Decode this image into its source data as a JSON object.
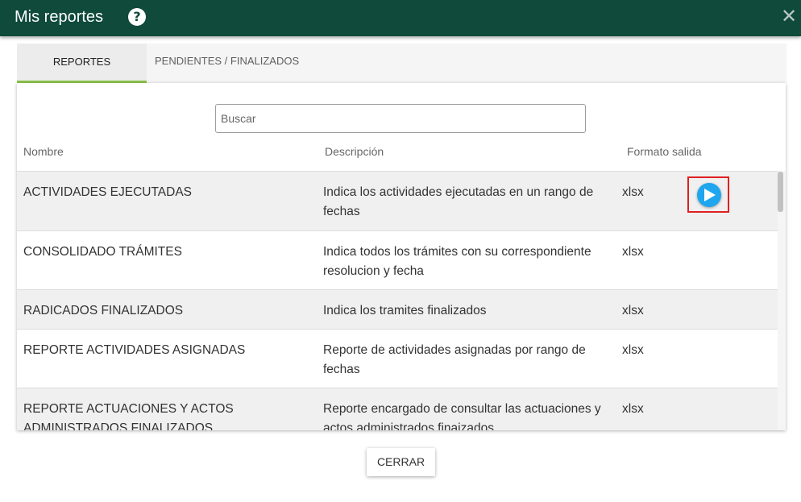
{
  "dialog": {
    "title": "Mis reportes",
    "help_glyph": "?",
    "close_glyph": "✕"
  },
  "tabs": [
    {
      "label": "REPORTES",
      "active": true
    },
    {
      "label": "PENDIENTES / FINALIZADOS",
      "active": false
    }
  ],
  "search": {
    "placeholder": "Buscar",
    "value": ""
  },
  "columns": {
    "name": "Nombre",
    "description": "Descripción",
    "format": "Formato salida"
  },
  "rows": [
    {
      "name": "ACTIVIDADES EJECUTADAS",
      "description": "Indica los actividades ejecutadas en un rango de fechas",
      "format": "xlsx"
    },
    {
      "name": "CONSOLIDADO TRÁMITES",
      "description": "Indica todos los trámites con su correspondiente resolucion y fecha",
      "format": "xlsx"
    },
    {
      "name": "RADICADOS FINALIZADOS",
      "description": "Indica los tramites finalizados",
      "format": "xlsx"
    },
    {
      "name": "REPORTE ACTIVIDADES ASIGNADAS",
      "description": "Reporte de actividades asignadas por rango de fechas",
      "format": "xlsx"
    },
    {
      "name": "REPORTE ACTUACIONES Y ACTOS ADMINISTRADOS FINALIZADOS",
      "description": "Reporte encargado de consultar las actuaciones y actos administrados finaizados",
      "format": "xlsx"
    }
  ],
  "footer": {
    "close_label": "CERRAR"
  },
  "colors": {
    "header": "#0f4a3a",
    "tab_underline": "#8bc34a",
    "play_button": "#1fa6ee",
    "highlight_box": "#e02020"
  }
}
